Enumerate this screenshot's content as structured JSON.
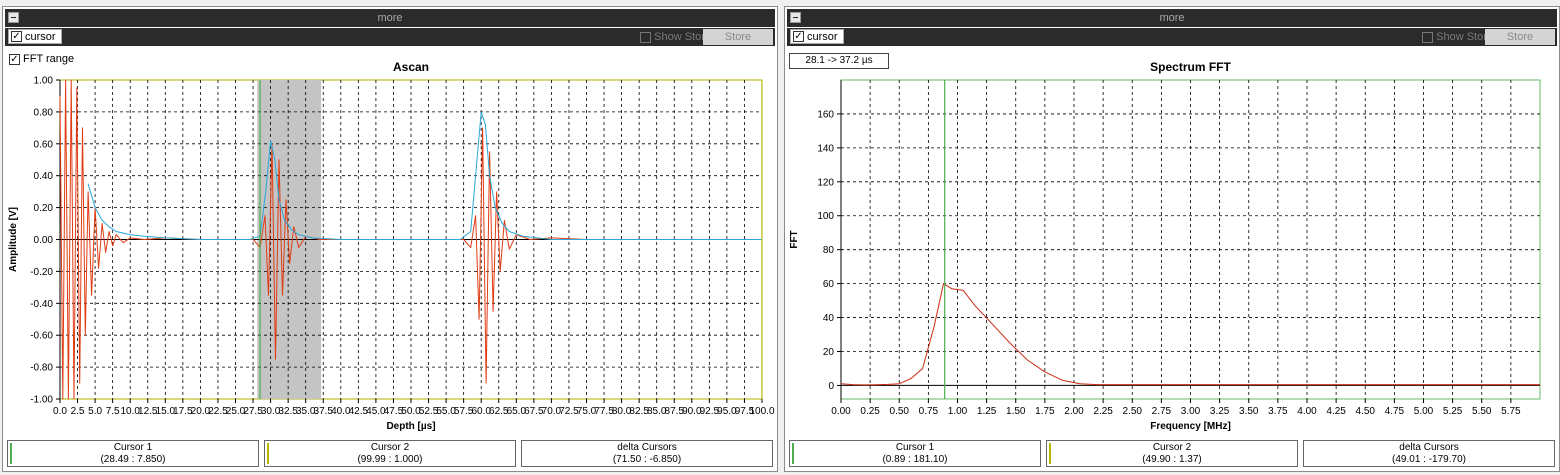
{
  "left_panel": {
    "more_label": "more",
    "cursor_label": "cursor",
    "cursor_checked": true,
    "show_store_label": "Show Store",
    "store_label": "Store",
    "fft_range_label": "FFT range",
    "fft_range_checked": true,
    "cursors": [
      {
        "label": "Cursor 1",
        "value": "(28.49 : 7.850)",
        "color": "#4caf50"
      },
      {
        "label": "Cursor 2",
        "value": "(99.99 : 1.000)",
        "color": "#b8b800"
      },
      {
        "label": "delta Cursors",
        "value": "(71.50 : -6.850)",
        "color": ""
      }
    ]
  },
  "right_panel": {
    "more_label": "more",
    "cursor_label": "cursor",
    "cursor_checked": true,
    "show_store_label": "Show Store",
    "store_label": "Store",
    "range_label": "28.1 -> 37.2 µs",
    "cursors": [
      {
        "label": "Cursor 1",
        "value": "(0.89 : 181.10)",
        "color": "#4caf50"
      },
      {
        "label": "Cursor 2",
        "value": "(49.90 : 1.37)",
        "color": "#b8b800"
      },
      {
        "label": "delta Cursors",
        "value": "(49.01 : -179.70)",
        "color": ""
      }
    ]
  },
  "chart_data": [
    {
      "type": "line",
      "title": "Ascan",
      "xlabel": "Depth [µs]",
      "ylabel": "Amplitude [V]",
      "xlim": [
        0,
        100
      ],
      "ylim": [
        -1,
        1
      ],
      "x_ticks": [
        "0.0",
        "2.5",
        "5.0",
        "7.5",
        "10.0",
        "12.5",
        "15.0",
        "17.5",
        "20.0",
        "22.5",
        "25.0",
        "27.5",
        "30.0",
        "32.5",
        "35.0",
        "37.5",
        "40.0",
        "42.5",
        "45.0",
        "47.5",
        "50.0",
        "52.5",
        "55.0",
        "57.5",
        "60.0",
        "62.5",
        "65.0",
        "67.5",
        "70.0",
        "72.5",
        "75.0",
        "77.5",
        "80.0",
        "82.5",
        "85.0",
        "87.5",
        "90.0",
        "92.5",
        "95.0",
        "97.5",
        "100.0"
      ],
      "y_ticks": [
        "1.00",
        "0.80",
        "0.60",
        "0.40",
        "0.20",
        "0.00",
        "-0.20",
        "-0.40",
        "-0.60",
        "-0.80",
        "-1.00"
      ],
      "grid": true,
      "fft_range": [
        28.1,
        37.2
      ],
      "cursor1_x": 28.49,
      "cursor2_x": 99.99,
      "series": [
        {
          "color": "#e03c14",
          "x": [
            0,
            0.4,
            0.8,
            1.2,
            1.6,
            2.0,
            2.4,
            2.8,
            3.2,
            3.6,
            4.0,
            4.5,
            5.0,
            5.5,
            6.0,
            6.5,
            7.0,
            7.5,
            8.0,
            9.0,
            10,
            12,
            15,
            20,
            27.5,
            28.5,
            29.2,
            29.7,
            30.2,
            30.7,
            31.2,
            31.7,
            32.2,
            32.7,
            33.3,
            34,
            35,
            37,
            40,
            50,
            57.5,
            58.5,
            59.2,
            59.7,
            60.2,
            60.7,
            61.2,
            61.7,
            62.2,
            62.7,
            63.3,
            64,
            65,
            67,
            70,
            75,
            78,
            80,
            90,
            100
          ],
          "y": [
            0.9,
            -1.0,
            1.0,
            -1.0,
            1.0,
            -1.0,
            0.95,
            -0.9,
            0.7,
            -0.6,
            0.3,
            -0.35,
            0.2,
            -0.18,
            0.1,
            -0.08,
            0.05,
            -0.04,
            0.03,
            -0.02,
            0.01,
            0.0,
            0.01,
            0.0,
            0.0,
            -0.05,
            0.15,
            -0.35,
            0.6,
            -0.75,
            0.5,
            -0.35,
            0.25,
            -0.15,
            0.08,
            -0.05,
            0.02,
            0.0,
            0.0,
            0.0,
            0.0,
            -0.05,
            0.15,
            -0.5,
            0.7,
            -0.9,
            0.55,
            -0.45,
            0.3,
            -0.2,
            0.12,
            -0.06,
            0.03,
            0.0,
            0.01,
            0.0,
            0.0,
            0.0,
            0.0,
            0.0
          ]
        },
        {
          "color": "#2aa8d8",
          "x": [
            4,
            5,
            6,
            7,
            8,
            10,
            12,
            15,
            20,
            27,
            28.5,
            29.3,
            30,
            30.6,
            31.2,
            32,
            33,
            34,
            36,
            40,
            50,
            57,
            58.5,
            59.3,
            60,
            60.6,
            61.2,
            62,
            63,
            64,
            66,
            70,
            80,
            100
          ],
          "y": [
            0.35,
            0.2,
            0.12,
            0.08,
            0.05,
            0.03,
            0.02,
            0.01,
            0.0,
            0.0,
            0.02,
            0.3,
            0.62,
            0.5,
            0.25,
            0.12,
            0.06,
            0.03,
            0.01,
            0.0,
            0.0,
            0.0,
            0.05,
            0.45,
            0.8,
            0.72,
            0.4,
            0.2,
            0.1,
            0.05,
            0.02,
            0.0,
            0.0,
            0.0
          ]
        }
      ]
    },
    {
      "type": "line",
      "title": "Spectrum FFT",
      "xlabel": "Frequency [MHz]",
      "ylabel": "FFT",
      "xlim": [
        0,
        6.0
      ],
      "ylim": [
        -8,
        180
      ],
      "x_ticks": [
        "0.00",
        "0.25",
        "0.50",
        "0.75",
        "1.00",
        "1.25",
        "1.50",
        "1.75",
        "2.00",
        "2.25",
        "2.50",
        "2.75",
        "3.00",
        "3.25",
        "3.50",
        "3.75",
        "4.00",
        "4.25",
        "4.50",
        "4.75",
        "5.00",
        "5.25",
        "5.50",
        "5.75"
      ],
      "y_ticks": [
        "160",
        "140",
        "120",
        "100",
        "80",
        "60",
        "40",
        "20",
        "0"
      ],
      "grid": true,
      "cursor1_x": 0.89,
      "series": [
        {
          "color": "#cc2a10",
          "x": [
            0,
            0.1,
            0.2,
            0.3,
            0.4,
            0.5,
            0.6,
            0.7,
            0.8,
            0.88,
            0.95,
            1.05,
            1.15,
            1.3,
            1.45,
            1.6,
            1.75,
            1.9,
            2.05,
            2.2,
            2.5,
            3,
            4,
            5,
            6
          ],
          "y": [
            1,
            0.5,
            0.3,
            0.4,
            0.6,
            1,
            4,
            10,
            35,
            60,
            57,
            56,
            47,
            36,
            25,
            15,
            8,
            3,
            1,
            0.5,
            0.5,
            0.5,
            0.5,
            0.5,
            0.5
          ]
        }
      ]
    }
  ]
}
